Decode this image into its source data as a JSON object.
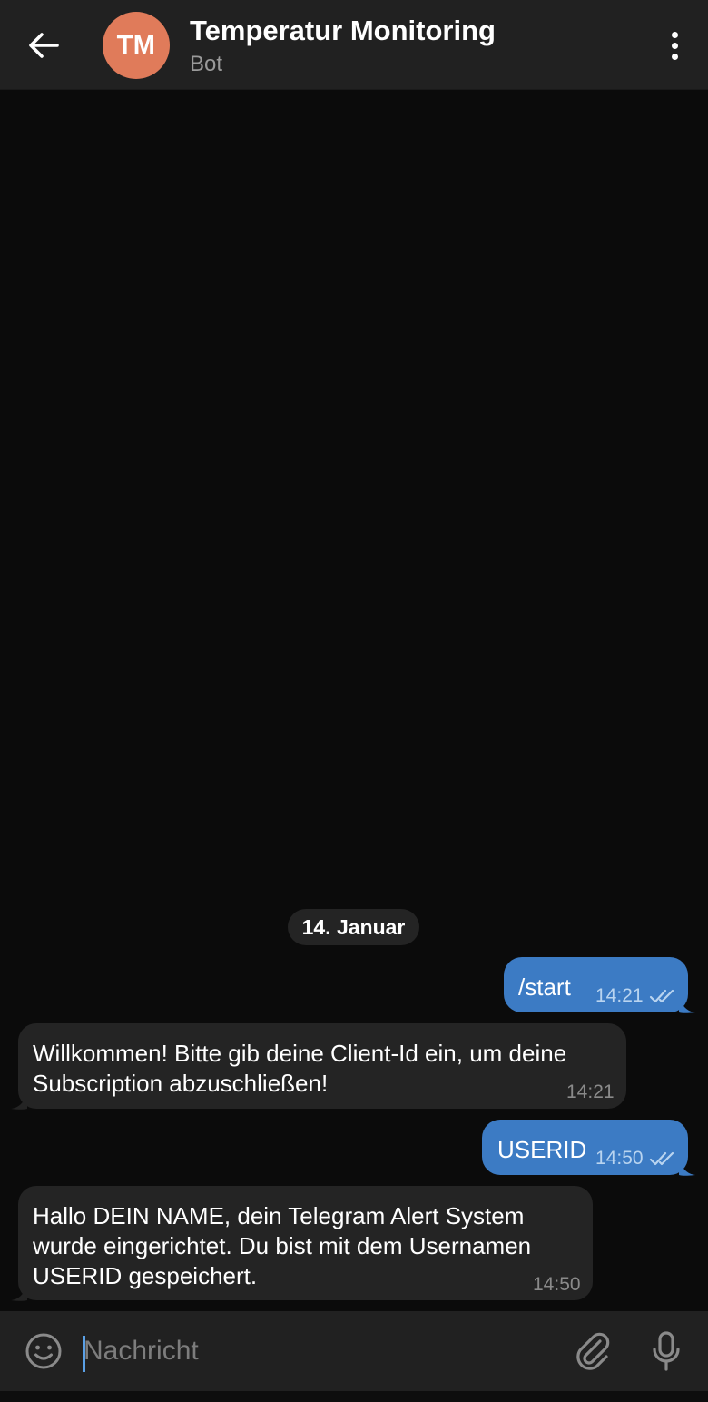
{
  "header": {
    "avatar_initials": "TM",
    "avatar_color": "#e07b5a",
    "title": "Temperatur Monitoring",
    "subtitle": "Bot",
    "back_icon": "arrow-left-icon",
    "menu_icon": "more-vertical-icon"
  },
  "chat": {
    "date_label": "14. Januar",
    "messages": [
      {
        "direction": "out",
        "text": "/start",
        "time": "14:21",
        "status": "read"
      },
      {
        "direction": "in",
        "text": "Willkommen! Bitte gib deine Client-Id ein, um deine Subscription abzuschließen!",
        "time": "14:21"
      },
      {
        "direction": "out",
        "text": "USERID",
        "time": "14:50",
        "status": "read"
      },
      {
        "direction": "in",
        "text": "Hallo DEIN NAME, dein Telegram Alert System wurde eingerichtet. Du bist mit dem Usernamen USERID gespeichert.",
        "time": "14:50"
      }
    ]
  },
  "composer": {
    "placeholder": "Nachricht",
    "value": "",
    "emoji_icon": "emoji-icon",
    "attach_icon": "paperclip-icon",
    "mic_icon": "microphone-icon"
  },
  "colors": {
    "outgoing_bubble": "#3c7bc4",
    "incoming_bubble": "#242424",
    "background": "#0b0b0b",
    "header": "#212121"
  }
}
